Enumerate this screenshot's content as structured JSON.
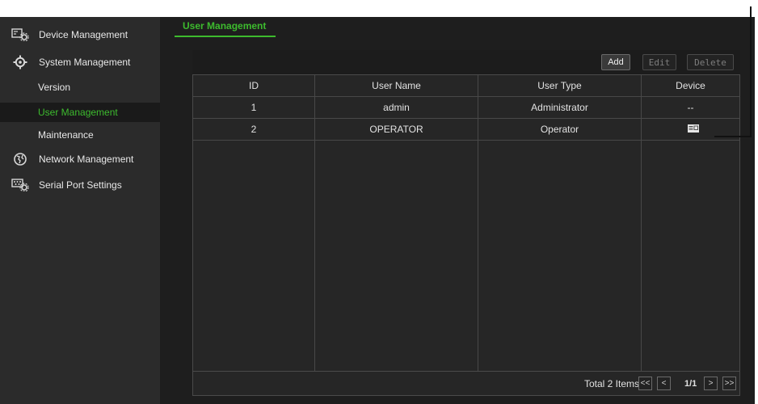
{
  "sidebar": {
    "items": [
      {
        "label": "Device Management",
        "icon": "device-settings-icon"
      },
      {
        "label": "System Management",
        "icon": "gear-icon"
      },
      {
        "label": "Version"
      },
      {
        "label": "User Management",
        "active": true
      },
      {
        "label": "Maintenance"
      },
      {
        "label": "Network Management",
        "icon": "globe-icon"
      },
      {
        "label": "Serial Port Settings",
        "icon": "serial-port-icon"
      }
    ]
  },
  "tab": {
    "label": "User Management"
  },
  "toolbar": {
    "add_label": "Add",
    "edit_label": "Edit",
    "delete_label": "Delete"
  },
  "table": {
    "columns": [
      "ID",
      "User Name",
      "User Type",
      "Device"
    ],
    "rows": [
      {
        "id": "1",
        "name": "admin",
        "type": "Administrator",
        "device": "--"
      },
      {
        "id": "2",
        "name": "OPERATOR",
        "type": "Operator",
        "device_icon": "device-list-icon"
      }
    ]
  },
  "pagination": {
    "total": "Total 2 Items",
    "first": "<<",
    "prev": "<",
    "page": "1/1",
    "next": ">",
    "last": ">>"
  },
  "colors": {
    "accent": "#3dbb2e",
    "background": "#1e1e1e",
    "sidebar": "#2b2b2b"
  }
}
